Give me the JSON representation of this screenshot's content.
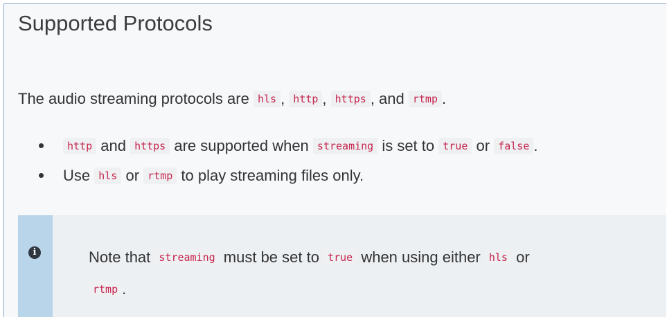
{
  "heading": "Supported Protocols",
  "intro": {
    "t1": "The audio streaming protocols are ",
    "c1": "hls",
    "t2": ", ",
    "c2": "http",
    "t3": ", ",
    "c3": "https",
    "t4": ", and ",
    "c4": "rtmp",
    "t5": "."
  },
  "bullets": [
    {
      "c1": "http",
      "t1": " and ",
      "c2": "https",
      "t2": " are supported when ",
      "c3": "streaming",
      "t3": " is set to ",
      "c4": "true",
      "t4": " or ",
      "c5": "false",
      "t5": "."
    },
    {
      "t1": "Use ",
      "c1": "hls",
      "t2": " or ",
      "c2": "rtmp",
      "t3": " to play streaming files only."
    }
  ],
  "note": {
    "icon_glyph": "i",
    "icon": "info-circle-icon",
    "t1": "Note that ",
    "c1": "streaming",
    "t2": " must be set to ",
    "c2": "true",
    "t3": " when using either ",
    "c3": "hls",
    "t4": " or ",
    "c4": "rtmp",
    "t5": "."
  },
  "colors": {
    "code_text": "#c7254e",
    "code_bg": "#eef0f2",
    "note_bar": "#b9d5ea",
    "page_bg": "#f6f8fa"
  }
}
